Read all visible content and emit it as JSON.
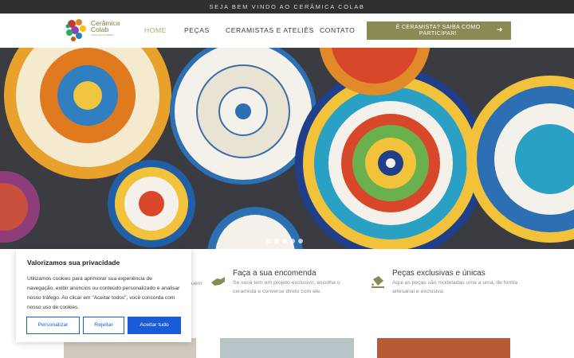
{
  "topbar": {
    "text": "SEJA BEM VINDO AO CERÂMICA COLAB"
  },
  "logo": {
    "line1": "Cerâmica",
    "line2": "Colab",
    "sub": "Juntos Somos Melhor"
  },
  "nav": [
    {
      "label": "HOME",
      "active": true
    },
    {
      "label": "PEÇAS",
      "active": false
    },
    {
      "label": "CERAMISTAS E ATELIÊS",
      "active": false
    },
    {
      "label": "CONTATO",
      "active": false
    }
  ],
  "cta": {
    "label": "É CERAMISTA? SAIBA COMO PARTICIPAR!",
    "icon": "arrow-right-icon"
  },
  "slider": {
    "slide_count": 5,
    "active_index": 1
  },
  "features": [
    {
      "title": "",
      "desc_fragment": "uem",
      "icon": ""
    },
    {
      "title": "Faça a sua encomenda",
      "desc": "Se você tem um projeto exclusivo, escolha o ceramista e converse direto com ele.",
      "icon": "hand-pointer-icon"
    },
    {
      "title": "Peças exclusivas e únicas",
      "desc": "Aqui as peças são modeladas uma a uma, de forma artesanal e exclusiva.",
      "icon": "paint-bucket-icon"
    }
  ],
  "cookie": {
    "title": "Valorizamos sua privacidade",
    "text": "Utilizamos cookies para aprimorar sua experiência de navegação, exibir anúncios ou conteúdo personalizado e analisar nosso tráfego. Ao clicar em \"Aceitar todos\", você concorda com nosso uso de cookies.",
    "customize": "Personalizar",
    "reject": "Rejeitar",
    "accept": "Aceitar tudo"
  },
  "colors": {
    "accent": "#8a8a55",
    "nav_active": "#a4ad6f",
    "cookie_blue": "#1a5bd8",
    "topbar": "#2f2f2f"
  }
}
